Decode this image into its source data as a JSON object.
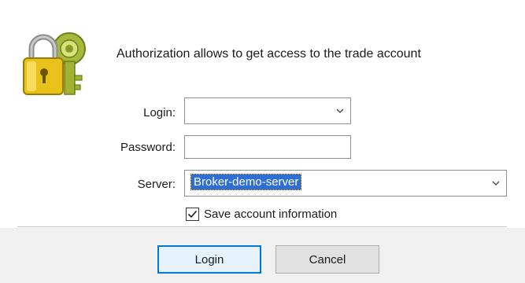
{
  "dialog": {
    "header_text": "Authorization allows to get access to the trade account",
    "icon": "padlock-key-icon"
  },
  "form": {
    "login_label": "Login:",
    "login_value": "",
    "password_label": "Password:",
    "password_value": "",
    "server_label": "Server:",
    "server_value": "Broker-demo-server",
    "save_info_label": "Save account information",
    "save_info_checked": true
  },
  "buttons": {
    "login": "Login",
    "cancel": "Cancel"
  },
  "colors": {
    "selection": "#2f6fd3",
    "lock_yellow": "#e8c21a",
    "key_green": "#a6b93a"
  }
}
